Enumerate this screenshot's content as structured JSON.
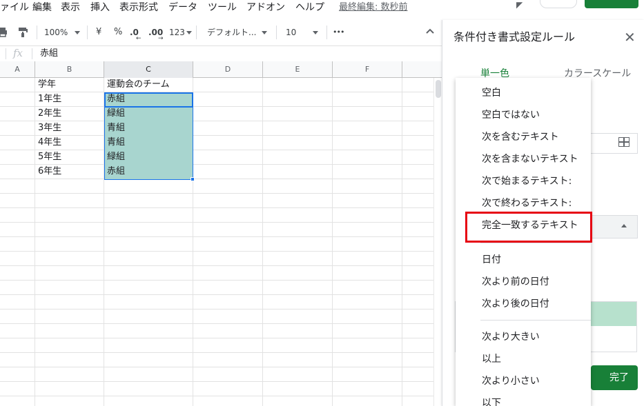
{
  "menu": {
    "items": [
      "ァイル",
      "編集",
      "表示",
      "挿入",
      "表示形式",
      "データ",
      "ツール",
      "アドオン",
      "ヘルプ"
    ],
    "last_edit": "最終編集: 数秒前"
  },
  "toolbar": {
    "zoom": "100%",
    "currency": "¥",
    "percent": "%",
    "decrease_decimal": ".0",
    "increase_decimal": ".00",
    "more_formats": "123",
    "font": "デフォルト...",
    "font_size": "10",
    "more": "•••",
    "collapse": "^",
    "icons": [
      "print-icon",
      "paint-format-icon",
      "chevron-up-icon",
      "more-icon"
    ]
  },
  "formula_bar": {
    "fx": "fx",
    "value": "赤組"
  },
  "grid": {
    "columns": [
      "A",
      "B",
      "C",
      "D",
      "E",
      "F"
    ],
    "rows": [
      [
        "",
        "学年",
        "運動会のチーム",
        "",
        "",
        ""
      ],
      [
        "",
        "1年生",
        "赤組",
        "",
        "",
        ""
      ],
      [
        "",
        "2年生",
        "緑組",
        "",
        "",
        ""
      ],
      [
        "",
        "3年生",
        "青組",
        "",
        "",
        ""
      ],
      [
        "",
        "4年生",
        "青組",
        "",
        "",
        ""
      ],
      [
        "",
        "5年生",
        "緑組",
        "",
        "",
        ""
      ],
      [
        "",
        "6年生",
        "赤組",
        "",
        "",
        ""
      ]
    ],
    "highlight_color": "#a8d5cf",
    "selection_color": "#1a73e8"
  },
  "panel": {
    "title": "条件付き書式設定ルール",
    "close": "✕",
    "tabs": [
      "単一色",
      "カラースケール"
    ],
    "done": "完了",
    "preview_color": "#b7e1cd",
    "accent": "#188038"
  },
  "dropdown": {
    "items": [
      "空白",
      "空白ではない",
      "次を含むテキスト",
      "次を含まないテキスト",
      "次で始まるテキスト:",
      "次で終わるテキスト:",
      "完全一致するテキスト",
      "日付",
      "次より前の日付",
      "次より後の日付",
      "次より大きい",
      "以上",
      "次より小さい",
      "以下"
    ],
    "highlighted": "完全一致するテキスト",
    "highlight_border_color": "#e60012"
  }
}
